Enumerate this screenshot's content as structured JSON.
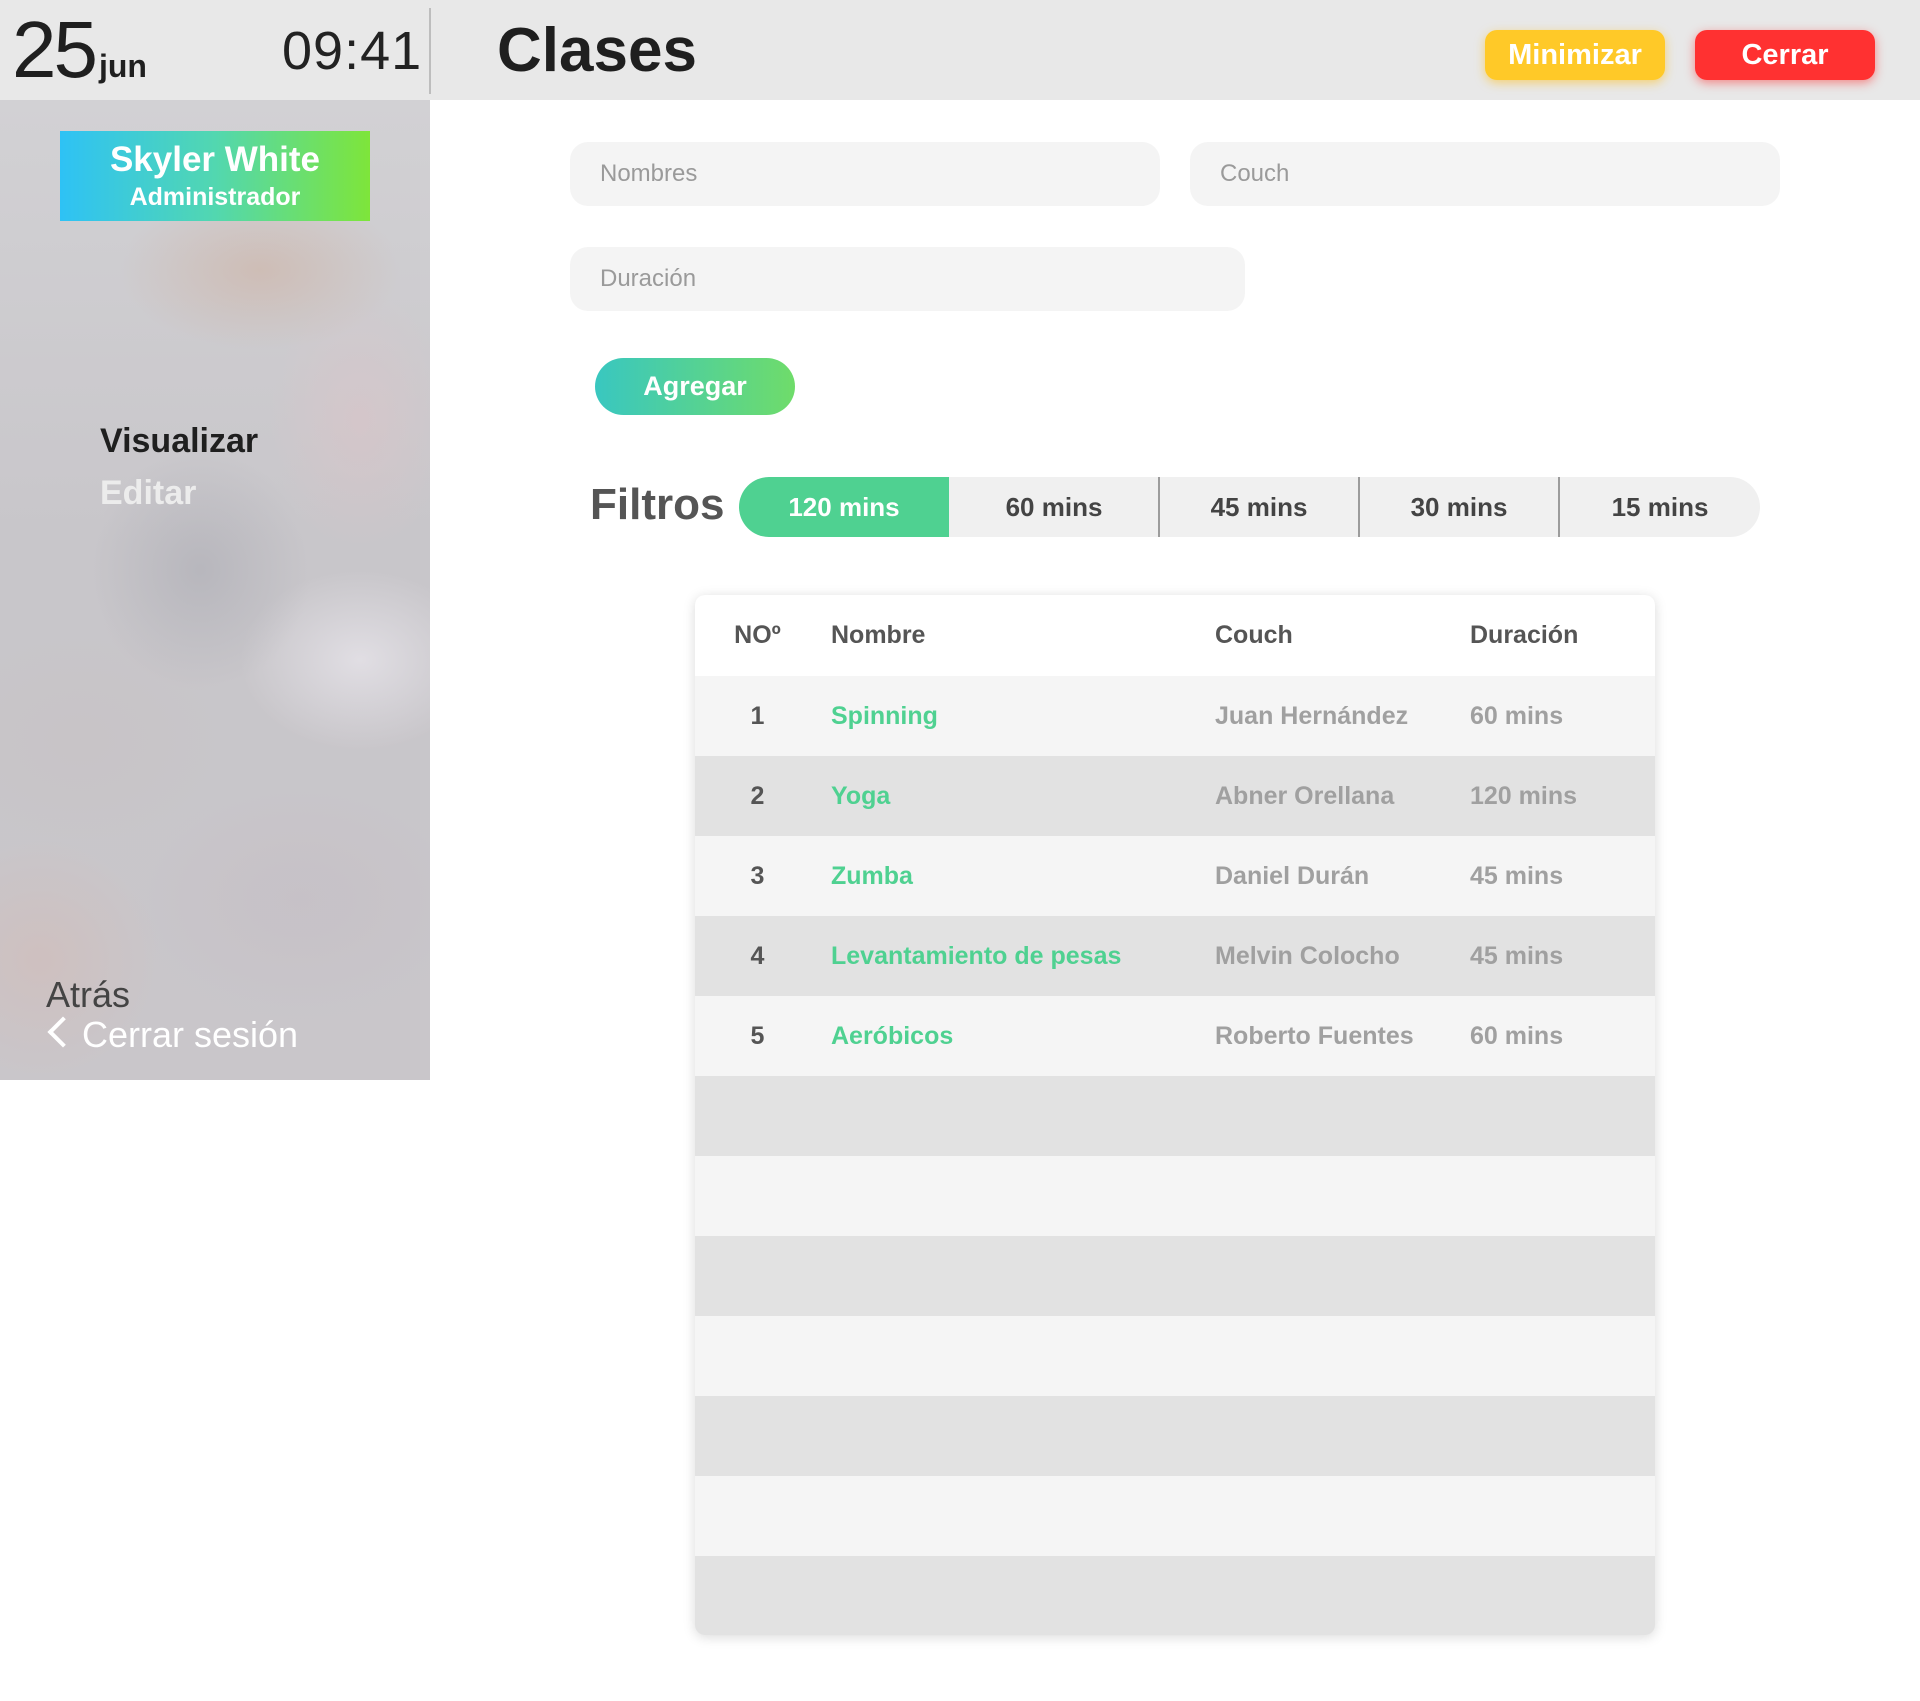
{
  "header": {
    "day": "25",
    "month": "jun",
    "time": "09:41",
    "title": "Clases",
    "minimize_label": "Minimizar",
    "close_label": "Cerrar"
  },
  "sidebar": {
    "user_name": "Skyler White",
    "user_role": "Administrador",
    "nav": [
      "Visualizar",
      "Editar"
    ],
    "back_label": "Atrás",
    "logout_label": "Cerrar sesión"
  },
  "form": {
    "nombres_placeholder": "Nombres",
    "couch_placeholder": "Couch",
    "duracion_placeholder": "Duración",
    "add_label": "Agregar"
  },
  "filters": {
    "label": "Filtros",
    "options": [
      "120 mins",
      "60 mins",
      "45 mins",
      "30 mins",
      "15 mins"
    ],
    "selected": "120 mins"
  },
  "table": {
    "columns": [
      "NOº",
      "Nombre",
      "Couch",
      "Duración"
    ],
    "rows": [
      {
        "no": "1",
        "nombre": "Spinning",
        "couch": "Juan Hernández",
        "duracion": "60 mins"
      },
      {
        "no": "2",
        "nombre": "Yoga",
        "couch": "Abner Orellana",
        "duracion": "120 mins"
      },
      {
        "no": "3",
        "nombre": "Zumba",
        "couch": "Daniel Durán",
        "duracion": "45 mins"
      },
      {
        "no": "4",
        "nombre": "Levantamiento de pesas",
        "couch": "Melvin Colocho",
        "duracion": "45 mins"
      },
      {
        "no": "5",
        "nombre": "Aeróbicos",
        "couch": "Roberto Fuentes",
        "duracion": "60 mins"
      }
    ],
    "empty_rows": 7
  },
  "colors": {
    "accent_green": "#4fd191",
    "minimize_yellow": "#ffc928",
    "close_red": "#ff3131"
  },
  "icons": {
    "logout": "chevron-left-icon"
  }
}
